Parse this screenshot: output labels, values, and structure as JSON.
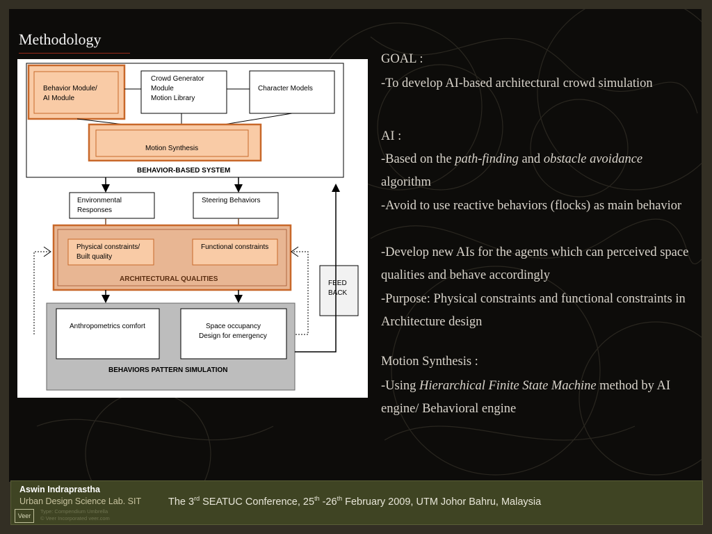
{
  "slide": {
    "title": "Methodology",
    "goal_heading": "GOAL :",
    "goal_text": "-To develop AI-based architectural crowd simulation",
    "ai_heading": "AI :",
    "ai_line1_pre": "-Based on the ",
    "ai_line1_em1": "path-finding",
    "ai_line1_mid": " and ",
    "ai_line1_em2": "obstacle avoidance",
    "ai_line1_post": " algorithm",
    "ai_line2": "-Avoid to use reactive behaviors (flocks) as main behavior",
    "ai_line3": "-Develop new AIs for the agents which can perceived space qualities and behave accordingly",
    "ai_line4": "-Purpose: Physical constraints and functional constraints in Architecture design",
    "motion_heading": "Motion Synthesis :",
    "motion_pre": "-Using ",
    "motion_em": "Hierarchical Finite State Machine",
    "motion_post": " method by AI engine/ Behavioral engine"
  },
  "diagram": {
    "behavior_module": [
      "Behavior Module/",
      "AI Module"
    ],
    "crowd_generator": [
      "Crowd Generator",
      "Module",
      "Motion Library"
    ],
    "character_models": "Character Models",
    "motion_synthesis": "Motion Synthesis",
    "behavior_based_system": "BEHAVIOR-BASED SYSTEM",
    "environmental_responses": [
      "Environmental",
      "Responses"
    ],
    "steering_behaviors": "Steering Behaviors",
    "physical_constraints": [
      "Physical   constraints/",
      "Built quality"
    ],
    "functional_constraints": "Functional constraints",
    "architectural_qualities": "ARCHITECTURAL QUALITIES",
    "feedback": [
      "FEED",
      "BACK"
    ],
    "anthropometrics": "Anthropometrics comfort",
    "space_occupancy": [
      "Space occupancy",
      "Design for emergency"
    ],
    "behaviors_pattern": "BEHAVIORS PATTERN SIMULATION"
  },
  "footer": {
    "author": "Aswin Indraprastha",
    "lab": "Urban Design Science Lab. SIT",
    "conf_pre": "The 3",
    "conf_sup1": "rd",
    "conf_mid1": " SEATUC Conference, 25",
    "conf_sup2": "th",
    "conf_mid2": " -26",
    "conf_sup3": "th",
    "conf_post": "  February 2009, UTM Johor Bahru, Malaysia",
    "logo": "Veer",
    "watermark1": "Type: Compendium Umbrella",
    "watermark2": "© Veer Incorporated   veer.com"
  },
  "colors": {
    "orange_fill": "#f9cba6",
    "orange_stroke": "#c8682a",
    "arch_fill": "#e8b693",
    "gray_fill": "#bdbdbd"
  }
}
